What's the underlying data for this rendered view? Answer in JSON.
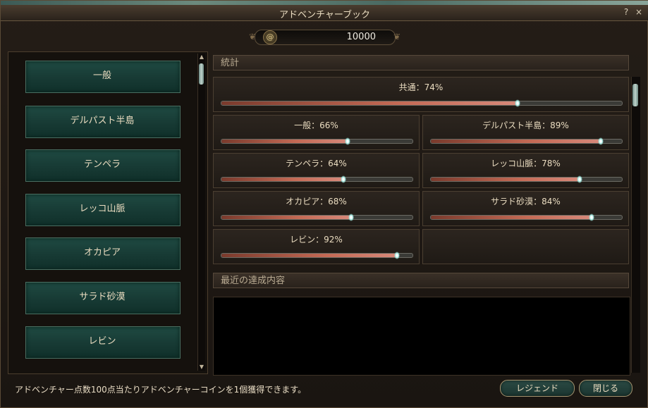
{
  "window": {
    "title": "アドベンチャーブック",
    "help_label": "?",
    "close_label": "×"
  },
  "coin": {
    "value": "10000"
  },
  "categories": [
    {
      "label": "一般"
    },
    {
      "label": "デルパスト半島"
    },
    {
      "label": "テンペラ"
    },
    {
      "label": "レッコ山脈"
    },
    {
      "label": "オカピア"
    },
    {
      "label": "サラド砂漠"
    },
    {
      "label": "レビン"
    }
  ],
  "statistics": {
    "header": "統計",
    "overall": {
      "label": "共通：74%",
      "percent": 74
    },
    "regions": [
      {
        "label": "一般：66%",
        "percent": 66
      },
      {
        "label": "デルパスト半島：89%",
        "percent": 89
      },
      {
        "label": "テンペラ：64%",
        "percent": 64
      },
      {
        "label": "レッコ山脈：78%",
        "percent": 78
      },
      {
        "label": "オカピア：68%",
        "percent": 68
      },
      {
        "label": "サラド砂漠：84%",
        "percent": 84
      },
      {
        "label": "レビン：92%",
        "percent": 92
      }
    ]
  },
  "recent": {
    "header": "最近の達成内容"
  },
  "footer": {
    "info": "アドベンチャー点数100点当たりアドベンチャーコインを1個獲得できます。",
    "legend_button": "レジェンド",
    "close_button": "閉じる"
  }
}
